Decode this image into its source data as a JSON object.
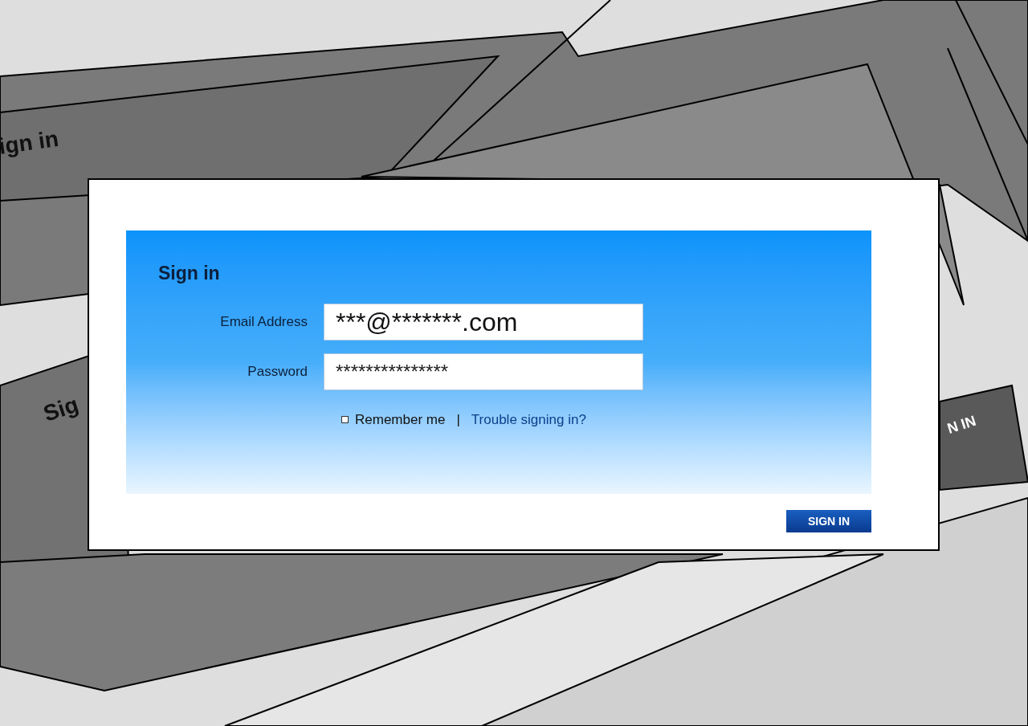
{
  "background": {
    "labels": [
      {
        "text": "ign in",
        "kind": "heading"
      },
      {
        "text": "Sig",
        "kind": "heading"
      },
      {
        "text": "N IN",
        "kind": "button"
      }
    ]
  },
  "form": {
    "title": "Sign in",
    "fields": [
      {
        "label": "Email Address",
        "value": "***@*******.com",
        "kind": "text"
      },
      {
        "label": "Password",
        "value": "***************",
        "kind": "password"
      }
    ],
    "remember": {
      "label": "Remember me",
      "checked": false
    },
    "separator": "|",
    "link": "Trouble signing in?",
    "submit": "SIGN IN"
  }
}
